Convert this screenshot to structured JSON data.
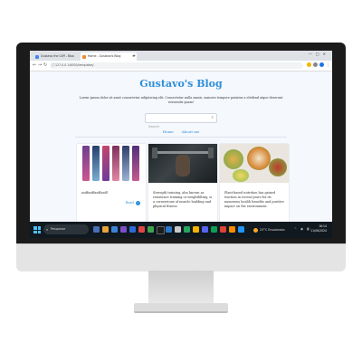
{
  "browser": {
    "tabs": [
      {
        "label": "Gustavo the Cliff - Bloo",
        "favicon_color": "#4285f4"
      },
      {
        "label": "Home - Gustavo's Blog",
        "favicon_color": "#f28b30"
      }
    ],
    "new_tab": "+",
    "url": "127.0.0.1:8000/templates/"
  },
  "blog": {
    "title": "Gustavo's Blog",
    "intro": "Lorem ipsum dolor sit amet consectetur adipisicing elit. Consectetur nulla omnis, maiores tempore pariatur a eleifend atque deserunt reiciendis quam!",
    "search_placeholder": "Search",
    "nav": [
      "Home",
      "About me"
    ]
  },
  "posts": [
    {
      "excerpt": "asdfasdfasdfasdf",
      "read_label": "Read"
    },
    {
      "excerpt": "Strength training, also known as resistance training or weightlifting, is a cornerstone of muscle building and physical fitness."
    },
    {
      "excerpt": "Plant-based nutrition has gained traction in recent years for its numerous health benefits and positive impact on the environment."
    }
  ],
  "taskbar": {
    "search_label": "Pesquisar",
    "weather": "23°C Ensolarado",
    "time": "16:14",
    "date": "11/06/2024"
  },
  "colors": {
    "accent": "#2f8fd8",
    "taskbar": "#101820"
  }
}
